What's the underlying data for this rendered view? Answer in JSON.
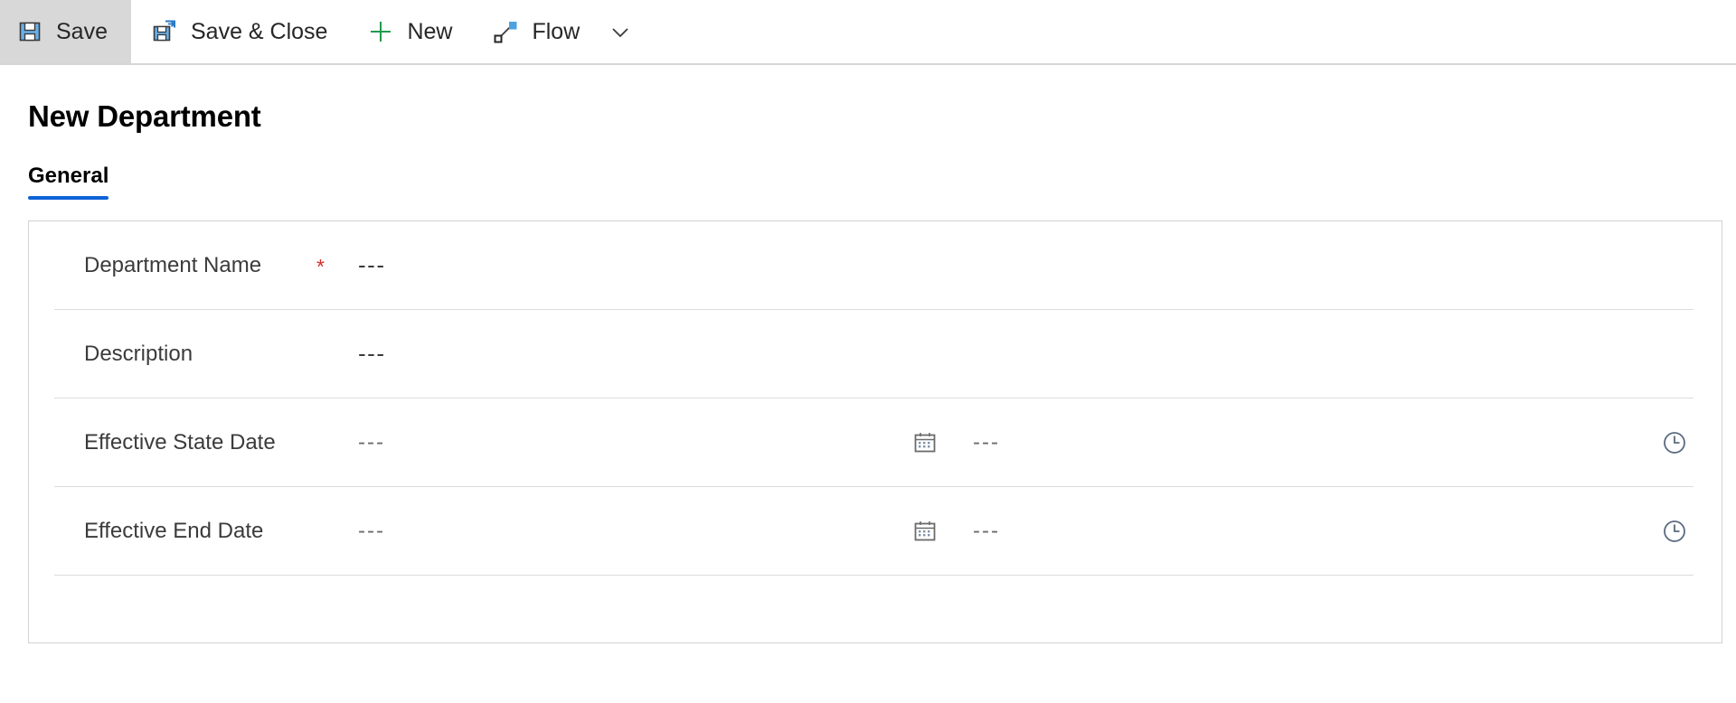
{
  "commandbar": {
    "buttons": [
      {
        "label": "Save",
        "icon": "save-icon",
        "selected": true
      },
      {
        "label": "Save & Close",
        "icon": "save-and-close-icon",
        "selected": false
      },
      {
        "label": "New",
        "icon": "plus-icon",
        "selected": false
      },
      {
        "label": "Flow",
        "icon": "flow-icon",
        "selected": false
      }
    ],
    "overflow_icon": "chevron-down-icon"
  },
  "page": {
    "title": "New Department"
  },
  "tabs": [
    {
      "label": "General",
      "active": true
    }
  ],
  "form": {
    "rows": [
      {
        "label": "Department Name",
        "required": true,
        "value": "---",
        "type": "text"
      },
      {
        "label": "Description",
        "required": false,
        "value": "---",
        "type": "text"
      },
      {
        "label": "Effective State Date",
        "required": false,
        "date_value": "---",
        "time_value": "---",
        "date_icon": "calendar-icon",
        "time_icon": "clock-icon",
        "type": "datetime"
      },
      {
        "label": "Effective End Date",
        "required": false,
        "date_value": "---",
        "time_value": "---",
        "date_icon": "calendar-icon",
        "time_icon": "clock-icon",
        "type": "datetime"
      }
    ]
  },
  "colors": {
    "accent": "#0f62d6",
    "required": "#d62f2f",
    "icon_blue": "#6ab0e8",
    "icon_dark": "#3b3b3b",
    "icon_green": "#1f9a4d",
    "selected_bg": "#d8d8d8",
    "border": "#d2d2d2"
  }
}
